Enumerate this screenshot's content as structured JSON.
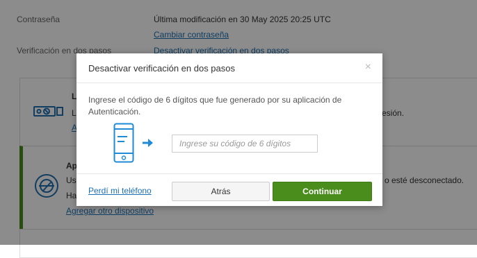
{
  "security": {
    "password_label": "Contraseña",
    "password_last_modified": "Última modificación en 30 May 2025 20:25 UTC",
    "change_password_link": "Cambiar contraseña",
    "two_step_label": "Verificación en dos pasos",
    "disable_two_step_link": "Desactivar verificación en dos pasos"
  },
  "background_cards": {
    "card1_title_fragment": "L",
    "card1_text_fragment": "L",
    "card1_link_fragment": "A",
    "card1_right_text": "esión.",
    "card2_title_fragment": "Ap",
    "card2_text_line1_fragment": "Us",
    "card2_text_line2_fragment": "Ha",
    "card2_right_text": "o esté desconectado.",
    "add_device_link": "Agregar otro dispositivo"
  },
  "modal": {
    "title": "Desactivar verificación en dos pasos",
    "close_symbol": "×",
    "instruction": "Ingrese el código de 6 dígitos que fue generado por su aplicación de Autenticación.",
    "code_placeholder": "Ingrese su código de 6 dígitos",
    "lost_phone_link": "Perdí mi teléfono",
    "back_button": "Atrás",
    "continue_button": "Continuar"
  },
  "colors": {
    "accent_green": "#4a8d1d",
    "link_blue": "#1a6fb3",
    "phone_blue": "#1f8ad6"
  },
  "icons": {
    "authenticator_card_icon": "security-key-icon",
    "app_card_icon": "authenticator-app-icon",
    "modal_phone_icon": "mobile-phone-icon",
    "modal_arrow_icon": "arrow-right-icon"
  }
}
